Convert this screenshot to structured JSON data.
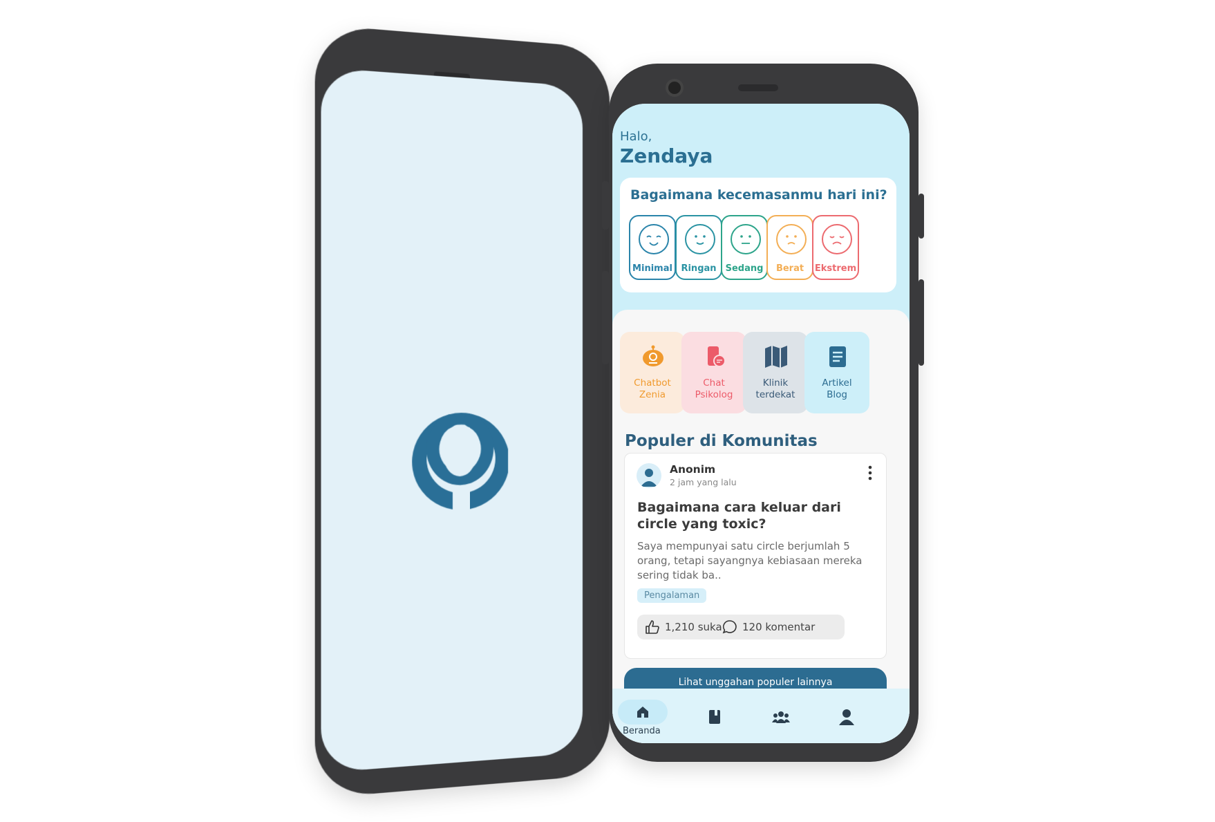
{
  "greeting": {
    "hello": "Halo,",
    "name": "Zendaya"
  },
  "mood": {
    "question": "Bagaimana kecemasanmu hari ini?",
    "options": [
      {
        "label": "Minimal",
        "color": "#2a84aa"
      },
      {
        "label": "Ringan",
        "color": "#2a93a3"
      },
      {
        "label": "Sedang",
        "color": "#2da48a"
      },
      {
        "label": "Berat",
        "color": "#f3ae55"
      },
      {
        "label": "Ekstrem",
        "color": "#ec6a6f"
      }
    ]
  },
  "features": [
    {
      "label_line1": "Chatbot",
      "label_line2": "Zenia",
      "bg": "#fcebdc",
      "color": "#f09a2e",
      "icon": "robot-icon"
    },
    {
      "label_line1": "Chat",
      "label_line2": "Psikolog",
      "bg": "#fbdde1",
      "color": "#ec5b69",
      "icon": "chat-phone-icon"
    },
    {
      "label_line1": "Klinik",
      "label_line2": "terdekat",
      "bg": "#dde3e8",
      "color": "#3a5a77",
      "icon": "map-icon"
    },
    {
      "label_line1": "Artikel",
      "label_line2": "Blog",
      "bg": "#cdeff9",
      "color": "#2c6c91",
      "icon": "article-icon"
    }
  ],
  "community": {
    "section_title": "Populer di Komunitas",
    "post": {
      "author": "Anonim",
      "time": "2 jam yang lalu",
      "title": "Bagaimana cara keluar dari circle yang toxic?",
      "body": "Saya mempunyai satu circle berjumlah 5 orang, tetapi sayangnya kebiasaan mereka sering tidak ba..",
      "tag": "Pengalaman",
      "likes": "1,210 suka",
      "comments": "120 komentar"
    },
    "cta": "Lihat unggahan populer lainnya"
  },
  "nav": {
    "home_label": "Beranda"
  },
  "colors": {
    "brand": "#2c6c91",
    "hero": "#cdeff9",
    "splash": "#e3f1f8"
  }
}
